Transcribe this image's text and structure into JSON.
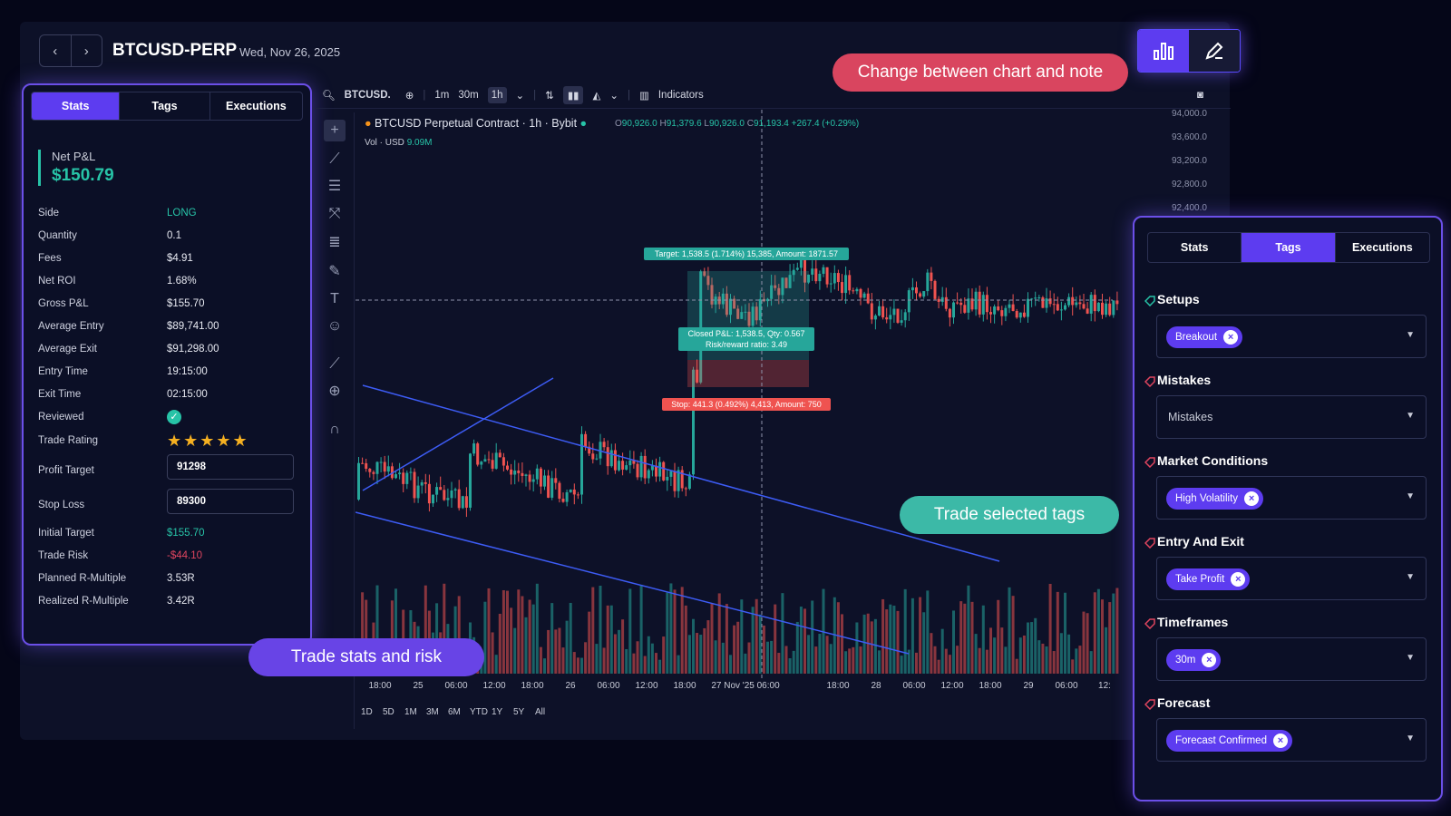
{
  "header": {
    "title": "BTCUSD-PERP",
    "date": "Wed, Nov 26, 2025",
    "prev": "‹",
    "next": "›"
  },
  "left_panel": {
    "tabs": [
      "Stats",
      "Tags",
      "Executions"
    ],
    "active_tab": "Stats",
    "net_pnl_label": "Net P&L",
    "net_pnl_value": "$150.79",
    "rows": [
      {
        "label": "Side",
        "value": "LONG"
      },
      {
        "label": "Quantity",
        "value": "0.1"
      },
      {
        "label": "Fees",
        "value": "$4.91"
      },
      {
        "label": "Net ROI",
        "value": "1.68%"
      },
      {
        "label": "Gross P&L",
        "value": "$155.70"
      },
      {
        "label": "Average Entry",
        "value": "$89,741.00"
      },
      {
        "label": "Average Exit",
        "value": "$91,298.00"
      },
      {
        "label": "Entry Time",
        "value": "19:15:00"
      },
      {
        "label": "Exit Time",
        "value": "02:15:00"
      },
      {
        "label": "Reviewed",
        "value": ""
      },
      {
        "label": "Trade Rating",
        "value": ""
      },
      {
        "label": "Profit Target",
        "value": "91298"
      },
      {
        "label": "Stop Loss",
        "value": "89300"
      },
      {
        "label": "Initial Target",
        "value": "$155.70"
      },
      {
        "label": "Trade Risk",
        "value": "-$44.10"
      },
      {
        "label": "Planned R-Multiple",
        "value": "3.53R"
      },
      {
        "label": "Realized R-Multiple",
        "value": "3.42R"
      }
    ],
    "rating_stars": 5,
    "colors": {
      "positive": "#27c3a7",
      "negative": "#e0455f",
      "accent": "#5d3cf0"
    }
  },
  "toolbar": {
    "symbol": "BTCUSD.",
    "intervals": [
      "1m",
      "30m",
      "1h"
    ],
    "active_interval": "1h",
    "indicators_label": "Indicators"
  },
  "chart_info": {
    "title": "BTCUSD Perpetual Contract · 1h · Bybit",
    "o": "90,926.0",
    "h": "91,379.6",
    "l": "90,926.0",
    "c": "91,193.4",
    "chg": "+267.4 (+0.29%)",
    "vol_label": "Vol · USD",
    "vol_value": "9.09M",
    "crosshair_label": "27 Nov '25  06:00"
  },
  "chart_data": {
    "type": "candlestick",
    "y_ticks": [
      "94,000.0",
      "93,600.0",
      "93,200.0",
      "92,800.0",
      "92,400.0"
    ],
    "x_ticks": [
      "18:00",
      "25",
      "06:00",
      "12:00",
      "18:00",
      "26",
      "06:00",
      "12:00",
      "18:00",
      "27 Nov '25  06:00",
      "18:00",
      "28",
      "06:00",
      "12:00",
      "18:00",
      "29",
      "06:00",
      "12:"
    ],
    "ranges": [
      "1D",
      "5D",
      "1M",
      "3M",
      "6M",
      "YTD",
      "1Y",
      "5Y",
      "All"
    ],
    "target_label": "Target: 1,538.5 (1.714%) 15,385, Amount: 1871.57",
    "closed_label_1": "Closed P&L: 1,538.5, Qty: 0.567",
    "closed_label_2": "Risk/reward ratio: 3.49",
    "stop_label": "Stop: 441.3 (0.492%) 4,413, Amount: 750",
    "colors": {
      "up": "#26a69a",
      "down": "#ef5350",
      "trend": "#3d5cf5"
    }
  },
  "callouts": {
    "chart_note": "Change between chart and note",
    "tags": "Trade selected tags",
    "stats": "Trade stats and risk"
  },
  "right_panel": {
    "tabs": [
      "Stats",
      "Tags",
      "Executions"
    ],
    "active_tab": "Tags",
    "sections": [
      {
        "title": "Setups",
        "chip": "Breakout",
        "placeholder": ""
      },
      {
        "title": "Mistakes",
        "chip": "",
        "placeholder": "Mistakes"
      },
      {
        "title": "Market Conditions",
        "chip": "High Volatility",
        "placeholder": ""
      },
      {
        "title": "Entry And Exit",
        "chip": "Take Profit",
        "placeholder": ""
      },
      {
        "title": "Timeframes",
        "chip": "30m",
        "placeholder": ""
      },
      {
        "title": "Forecast",
        "chip": "Forecast Confirmed",
        "placeholder": ""
      }
    ]
  }
}
